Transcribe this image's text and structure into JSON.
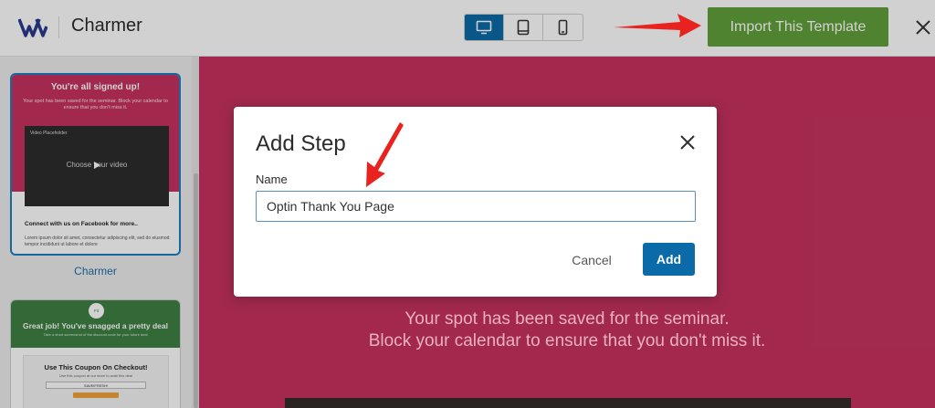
{
  "header": {
    "app_title": "Charmer",
    "import_label": "Import This Template",
    "devices": [
      "desktop-icon",
      "tablet-icon",
      "mobile-icon"
    ],
    "active_device": "desktop",
    "accent_color": "#0b6aa8",
    "import_color": "#61a03a"
  },
  "sidebar": {
    "template1": {
      "title": "You're all signed up!",
      "subtitle": "Your spot has been saved for the seminar. Block your calendar to ensure that you don't miss it.",
      "video_label": "Video Placeholder",
      "video_caption": "Choose your video",
      "connect_heading": "Connect with us on Facebook for more..",
      "lorem": "Lorem ipsum dolor sit amet, consectetur adipiscing elit, sed do eiusmod tempor incididunt ut labore et dolore",
      "name": "Charmer"
    },
    "template2": {
      "badge": "Fit",
      "title": "Great job! You've snagged a pretty deal",
      "subtitle": "Take a short screenshot of the discount code for your future deal",
      "coupon_title": "Use This Coupon On Checkout!",
      "coupon_sub": "Use this coupon at our store to avail this deal",
      "coupon_code": "SAVEIFRESH!"
    }
  },
  "preview": {
    "background": "#c6335f",
    "line1": "Your spot has been saved for the seminar.",
    "line2": "Block your calendar to ensure that you don't miss it."
  },
  "modal": {
    "title": "Add Step",
    "field_label": "Name",
    "field_value": "Optin Thank You Page",
    "cancel_label": "Cancel",
    "add_label": "Add"
  }
}
